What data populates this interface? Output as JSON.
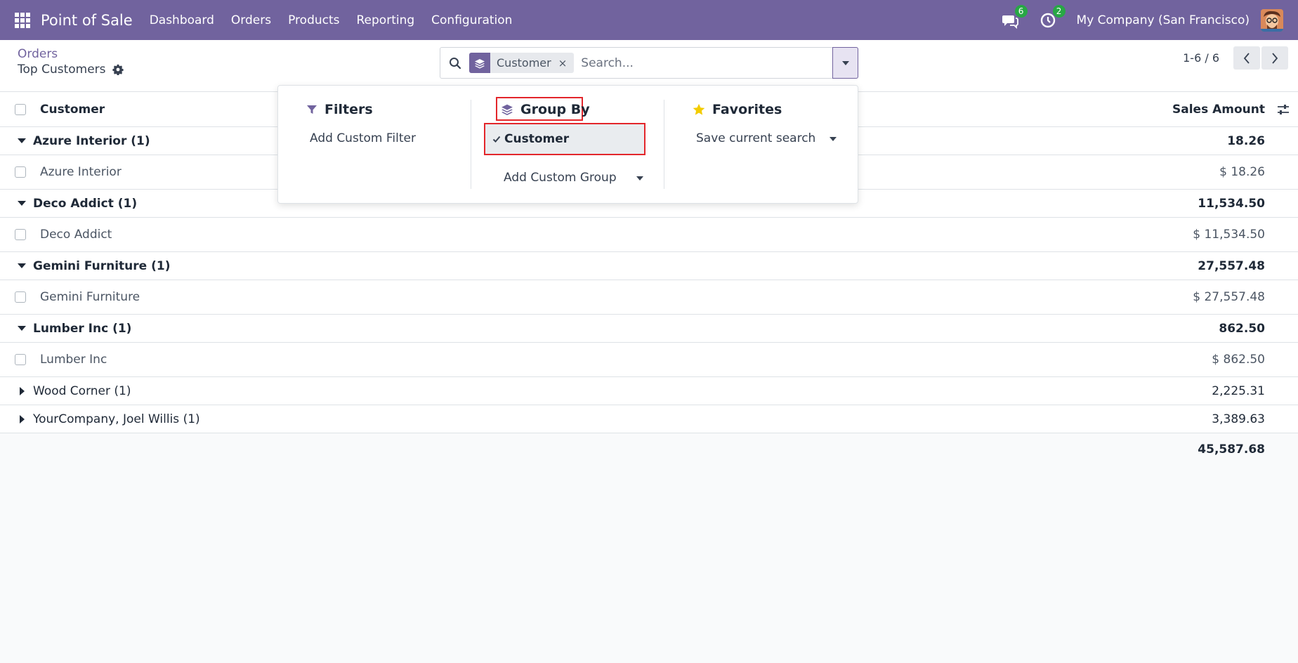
{
  "navbar": {
    "app_name": "Point of Sale",
    "menu": [
      "Dashboard",
      "Orders",
      "Products",
      "Reporting",
      "Configuration"
    ],
    "messages_badge": "6",
    "activities_badge": "2",
    "company": "My Company (San Francisco)",
    "bg_color": "#71639e"
  },
  "control_panel": {
    "breadcrumb": "Orders",
    "title": "Top Customers",
    "search": {
      "facet_label": "Customer",
      "facet_remove": "×",
      "placeholder": "Search..."
    },
    "pager": "1-6 / 6"
  },
  "dropdown": {
    "filters": {
      "title": "Filters",
      "add_custom": "Add Custom Filter"
    },
    "group_by": {
      "title": "Group By",
      "selected_item": "Customer",
      "add_custom": "Add Custom Group"
    },
    "favorites": {
      "title": "Favorites",
      "save_search": "Save current search"
    }
  },
  "list": {
    "columns": {
      "customer": "Customer",
      "amount": "Sales Amount"
    },
    "groups": [
      {
        "label": "Azure Interior (1)",
        "total": "18.26",
        "expanded": true,
        "record": {
          "name": "Azure Interior",
          "amount": "$ 18.26"
        }
      },
      {
        "label": "Deco Addict (1)",
        "total": "11,534.50",
        "expanded": true,
        "record": {
          "name": "Deco Addict",
          "amount": "$ 11,534.50"
        }
      },
      {
        "label": "Gemini Furniture (1)",
        "total": "27,557.48",
        "expanded": true,
        "record": {
          "name": "Gemini Furniture",
          "amount": "$ 27,557.48"
        }
      },
      {
        "label": "Lumber Inc (1)",
        "total": "862.50",
        "expanded": true,
        "record": {
          "name": "Lumber Inc",
          "amount": "$ 862.50"
        }
      },
      {
        "label": "Wood Corner (1)",
        "total": "2,225.31",
        "expanded": false
      },
      {
        "label": "YourCompany, Joel Willis (1)",
        "total": "3,389.63",
        "expanded": false
      }
    ],
    "grand_total": "45,587.68"
  }
}
